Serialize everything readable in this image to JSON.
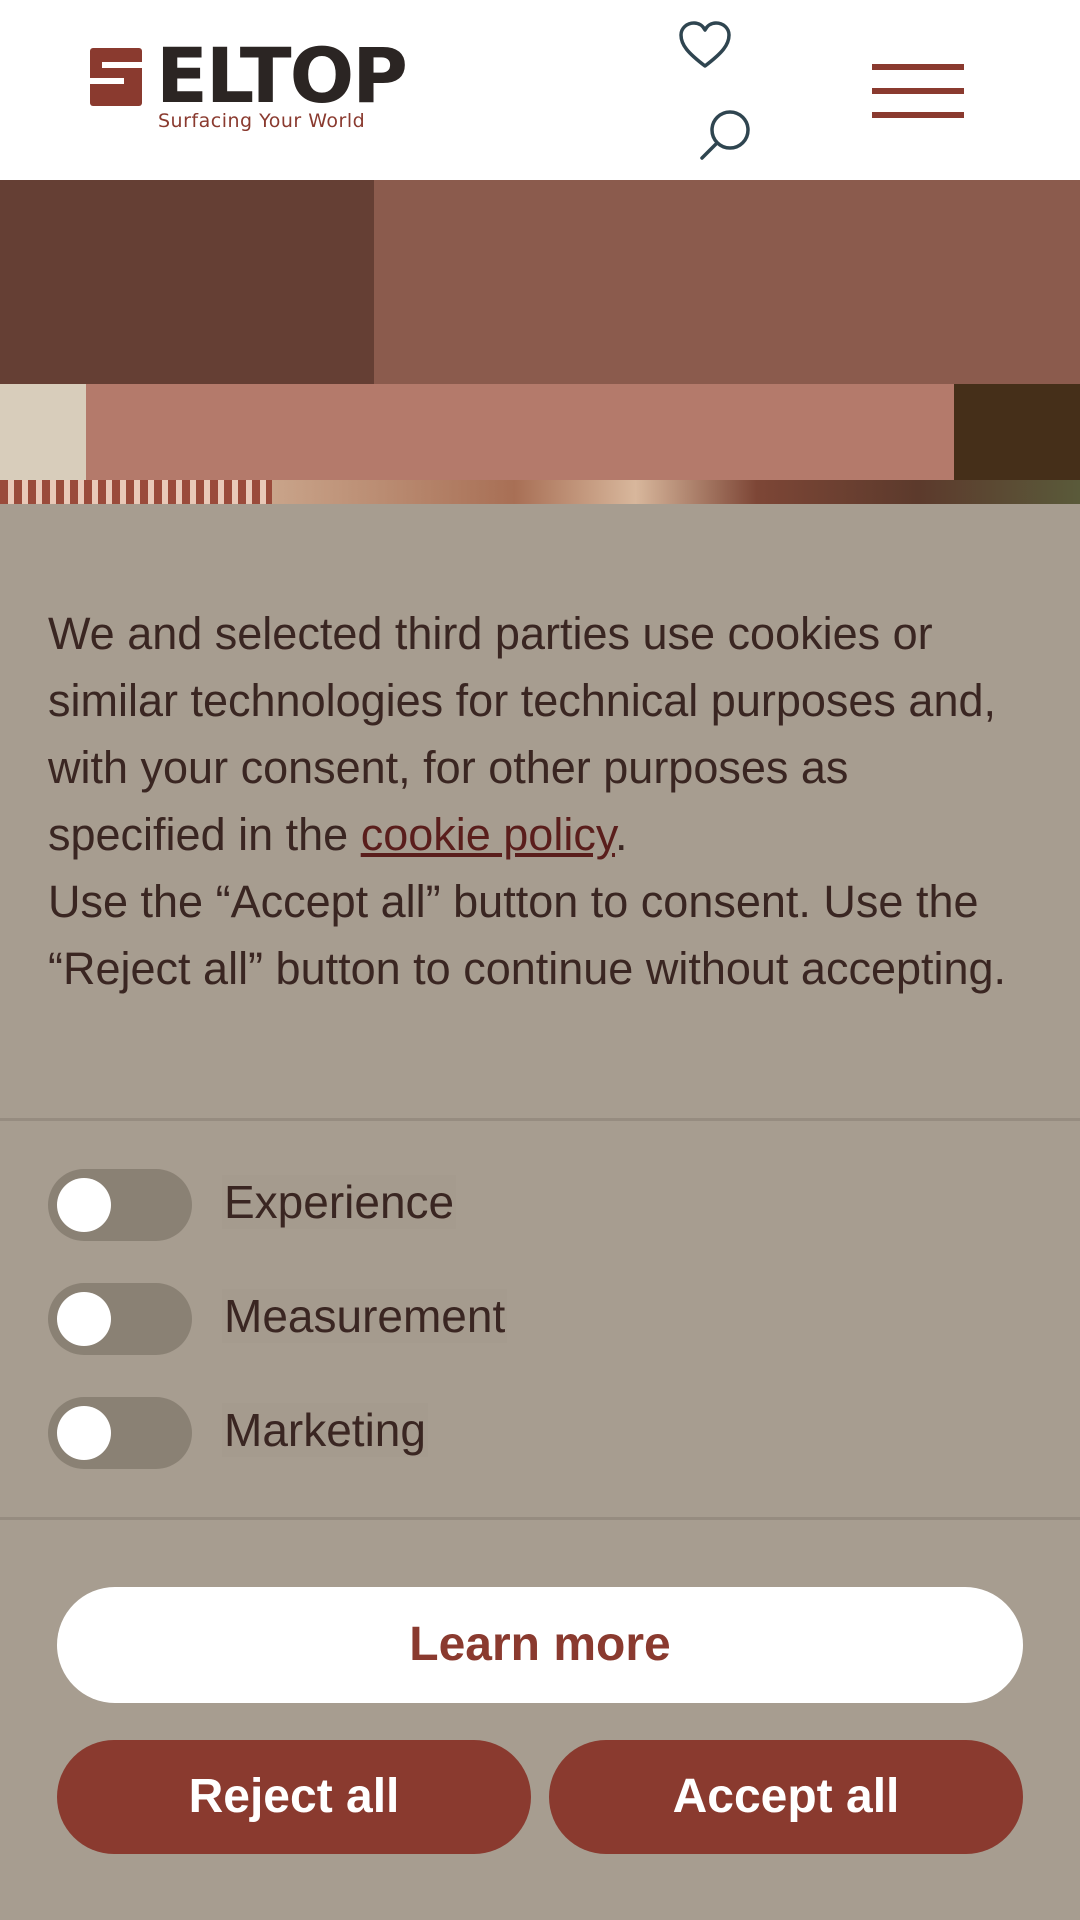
{
  "header": {
    "logo_word": "ELTOP",
    "logo_tagline": "Surfacing Your World",
    "icons": [
      "heart-icon",
      "search-icon",
      "hamburger-menu-icon"
    ]
  },
  "cookie_banner": {
    "text_part1": "We and selected third parties use cookies or similar technologies for technical purposes and, with your consent, for other purposes as specified in the ",
    "policy_link": "cookie policy",
    "text_part2": ".",
    "text_part3": "Use the “Accept all” button to consent. Use the “Reject all” button to continue without accepting.",
    "toggles": [
      {
        "label": "Experience",
        "enabled": false
      },
      {
        "label": "Measurement",
        "enabled": false
      },
      {
        "label": "Marketing",
        "enabled": false
      }
    ],
    "learn_more_label": "Learn more",
    "reject_label": "Reject all",
    "accept_label": "Accept all"
  },
  "colors": {
    "brand": "#8a3a2f",
    "panel_bg": "#a79d90",
    "text": "#3a2622",
    "toggle_off": "#8a8174"
  }
}
